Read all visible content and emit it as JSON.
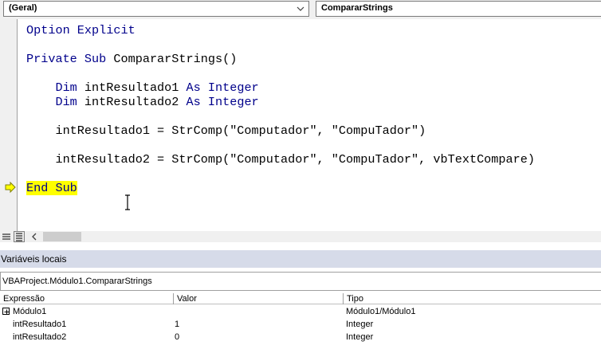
{
  "toolbar": {
    "object_combo": "(Geral)",
    "procedure_combo": "CompararStrings"
  },
  "code": {
    "lines": [
      [
        {
          "t": "Option Explicit",
          "k": true
        }
      ],
      [
        {
          "t": "Private Sub ",
          "k": true
        },
        {
          "t": "CompararStrings()",
          "k": false
        }
      ],
      [
        {
          "t": "    Dim ",
          "k": true
        },
        {
          "t": "intResultado1 ",
          "k": false
        },
        {
          "t": "As Integer",
          "k": true
        }
      ],
      [
        {
          "t": "    Dim ",
          "k": true
        },
        {
          "t": "intResultado2 ",
          "k": false
        },
        {
          "t": "As Integer",
          "k": true
        }
      ],
      [
        {
          "t": "    intResultado1 = StrComp(\"Computador\", \"CompuTador\")",
          "k": false
        }
      ],
      [
        {
          "t": "    intResultado2 = StrComp(\"Computador\", \"CompuTador\", vbTextCompare)",
          "k": false
        }
      ],
      [
        {
          "t": "End Sub",
          "k": true,
          "hl": true
        }
      ]
    ]
  },
  "locals": {
    "title": "Variáveis locais",
    "context": "VBAProject.Módulo1.CompararStrings",
    "columns": [
      "Expressão",
      "Valor",
      "Tipo"
    ],
    "rows": [
      {
        "expr": "Módulo1",
        "value": "",
        "type": "Módulo1/Módulo1",
        "expandable": true
      },
      {
        "expr": "intResultado1",
        "value": "1",
        "type": "Integer",
        "expandable": false
      },
      {
        "expr": "intResultado2",
        "value": "0",
        "type": "Integer",
        "expandable": false
      }
    ]
  },
  "colors": {
    "keyword": "#00008b",
    "highlight": "#ffff00",
    "locals_title_bg": "#d6dbe9"
  }
}
